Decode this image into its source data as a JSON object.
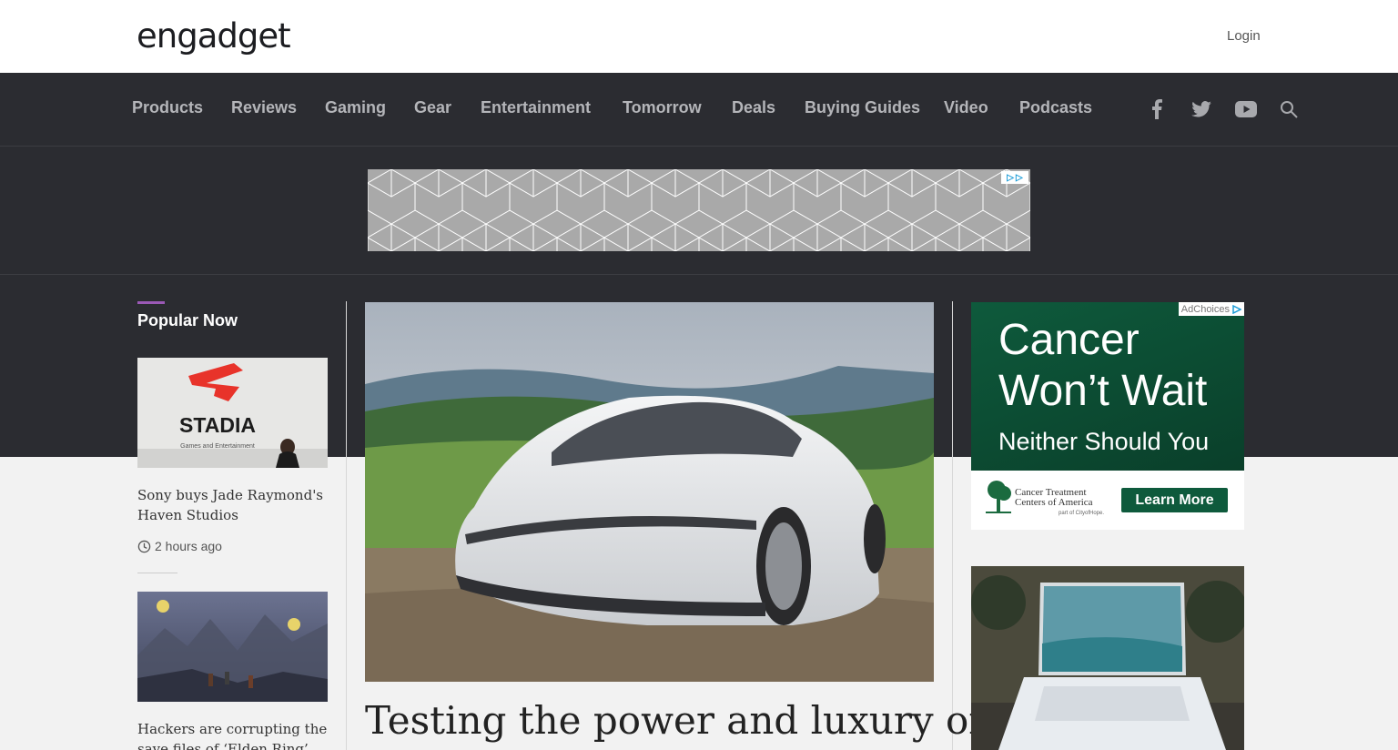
{
  "header": {
    "logo_text": "engadget",
    "login_label": "Login"
  },
  "nav": {
    "items": [
      "Products",
      "Reviews",
      "Gaming",
      "Gear",
      "Entertainment",
      "Tomorrow",
      "Deals",
      "Buying Guides",
      "Video",
      "Podcasts"
    ],
    "icons": [
      "facebook-icon",
      "twitter-icon",
      "youtube-icon",
      "search-icon"
    ]
  },
  "popular": {
    "heading": "Popular Now",
    "stories": [
      {
        "title": "Sony buys Jade Raymond's Haven Studios",
        "time": "2 hours ago",
        "image_brand": "STADIA",
        "image_caption": "Games and Entertainment"
      },
      {
        "title": "Hackers are corrupting the save files of ‘Elden Ring’"
      }
    ]
  },
  "hero": {
    "title": "Testing the power and luxury of"
  },
  "right_ad": {
    "adchoices_label": "AdChoices",
    "headline": "Cancer Won’t Wait",
    "subline": "Neither Should You",
    "sponsor_line1": "Cancer Treatment",
    "sponsor_line2": "Centers of America",
    "sponsor_sub": "part of CityofHope.",
    "button_label": "Learn More"
  },
  "colors": {
    "nav_bg": "#2b2c31",
    "nav_text": "#b4b5b9",
    "accent": "#9b59b6",
    "ad_green": "#0e5a3c"
  }
}
